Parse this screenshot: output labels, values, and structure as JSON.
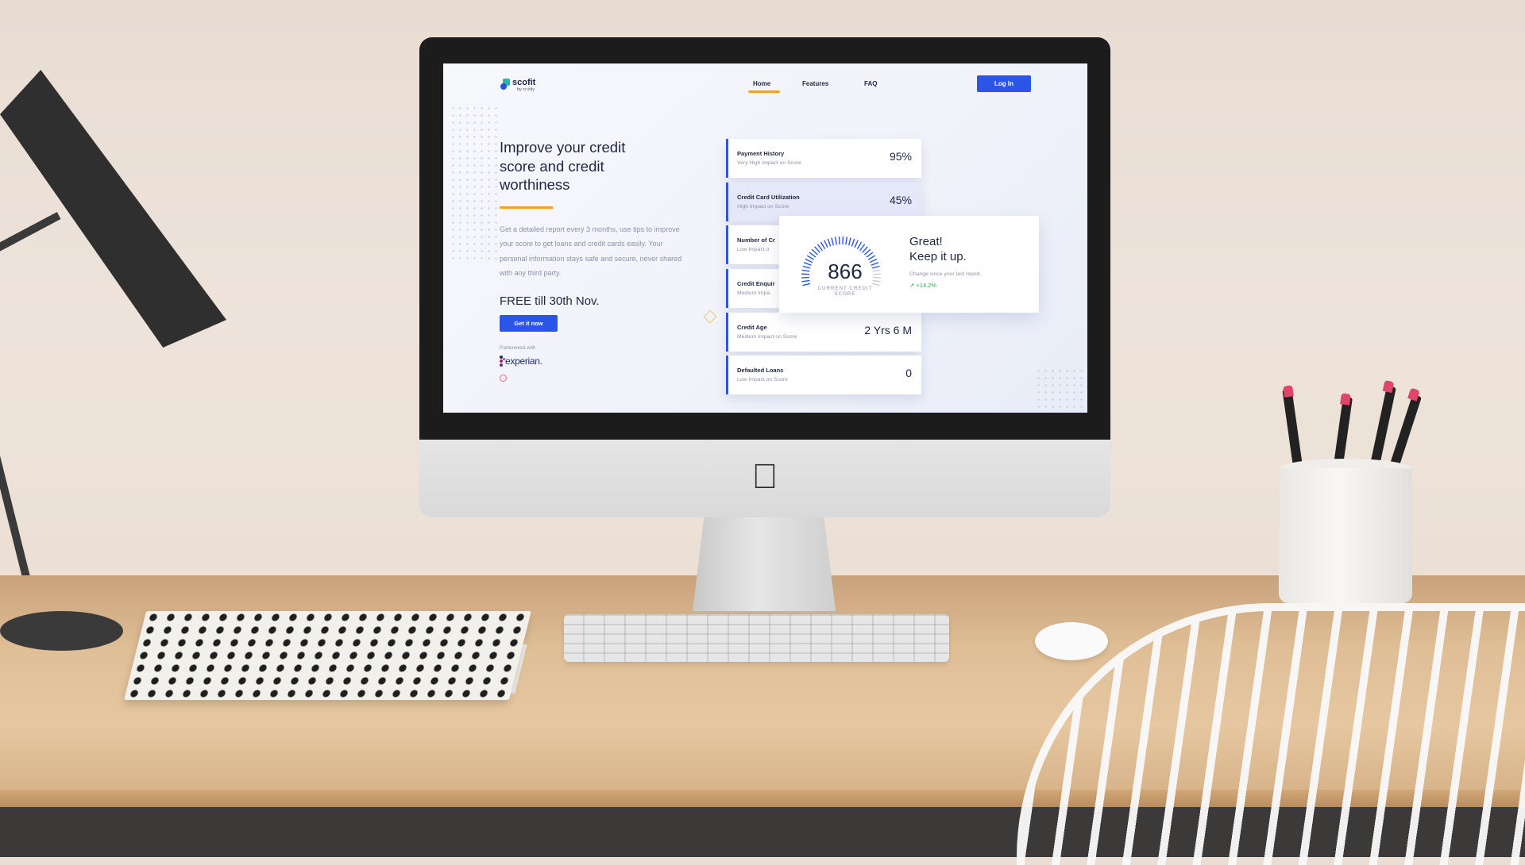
{
  "brand": {
    "name": "scofit",
    "byline": "by cr.edy"
  },
  "nav": {
    "items": [
      "Home",
      "Features",
      "FAQ"
    ],
    "active": "Home",
    "login_label": "Log In"
  },
  "hero": {
    "title": "Improve your credit score and credit worthiness",
    "description": "Get a detailed report every 3 months, use tips to improve your score to get loans and credit cards easily. Your personal information stays safe and secure, never shared with any third party.",
    "offer": "FREE till 30th Nov.",
    "cta_label": "Get it now",
    "partner_label": "Partenered with",
    "partner_name": "experian."
  },
  "factors": [
    {
      "title": "Payment History",
      "impact": "Very High Impact on Score",
      "value": "95%"
    },
    {
      "title": "Credit Card Utilization",
      "impact": "High Impact on Score",
      "value": "45%"
    },
    {
      "title": "Number of Cr",
      "impact": "Low Impact o",
      "value": ""
    },
    {
      "title": "Credit Enquir",
      "impact": "Medium Impa",
      "value": ""
    },
    {
      "title": "Credit Age",
      "impact": "Medium Impact on Score",
      "value": "2 Yrs 6 M"
    },
    {
      "title": "Defaulted Loans",
      "impact": "Low Impact on Score",
      "value": "0"
    }
  ],
  "score": {
    "value": "866",
    "label": "CURRENT CREDIT SCORE",
    "headline_1": "Great!",
    "headline_2": "Keep it up.",
    "change_label": "Change since your last report.",
    "change_value": "+14.2%"
  },
  "colors": {
    "accent": "#2b55e6",
    "highlight": "#f5a21a",
    "brand_teal": "#2bb5a4",
    "positive": "#2aa84a"
  }
}
